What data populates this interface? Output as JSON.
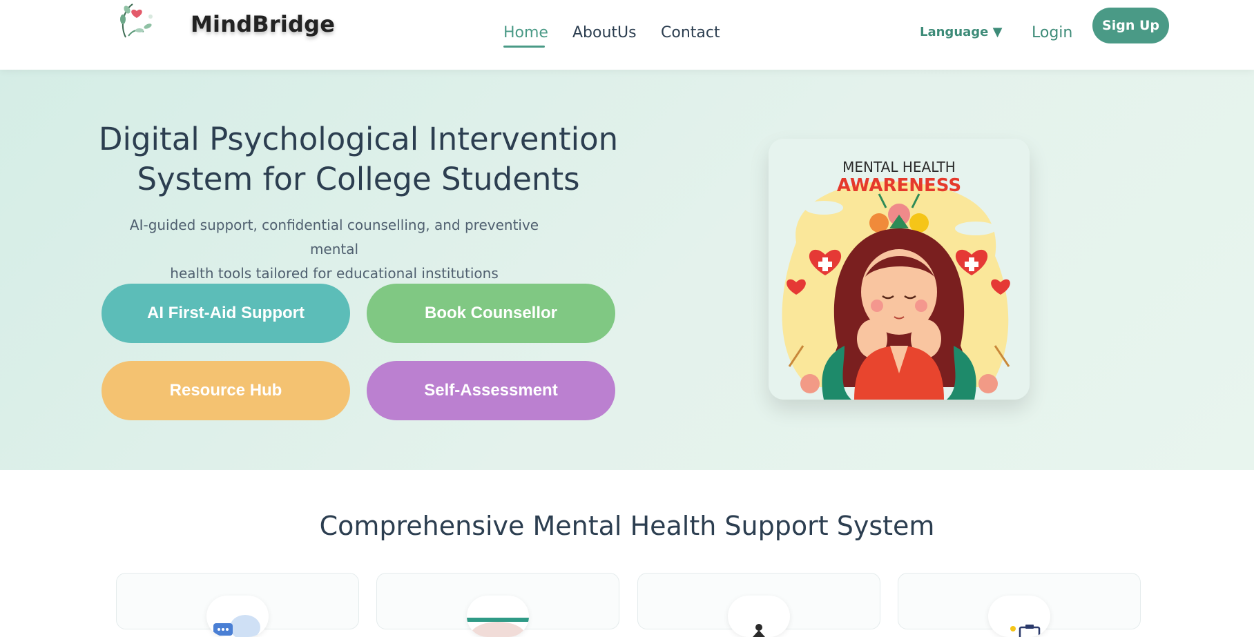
{
  "header": {
    "brand": "MindBridge",
    "nav": [
      "Home",
      "AboutUs",
      "Contact"
    ],
    "language_label": "Language ▼",
    "login_label": "Login",
    "signup_label": "Sign Up"
  },
  "hero": {
    "title_line1": "Digital Psychological Intervention",
    "title_line2": "System for College Students",
    "subtitle_line1": "AI-guided support, confidential counselling, and preventive mental",
    "subtitle_line2": "health tools tailored for educational institutions",
    "buttons": [
      "AI First-Aid Support",
      "Book Counsellor",
      "Resource Hub",
      "Self-Assessment"
    ],
    "poster": {
      "line1": "MENTAL HEALTH",
      "line2": "AWARENESS"
    }
  },
  "section": {
    "title": "Comprehensive Mental Health Support System",
    "cards": [
      {
        "icon": "chat-bubbles-icon"
      },
      {
        "icon": "counsellor-avatar-icon"
      },
      {
        "icon": "meditation-figure-icon"
      },
      {
        "icon": "clipboard-checklist-icon"
      }
    ]
  },
  "colors": {
    "accent": "#4a9a86",
    "ai_button": "#5cbdb8",
    "book_button": "#80c883",
    "resource_button": "#f4c271",
    "self_button": "#bb80d0",
    "hero_bg": "#e2f1eb"
  }
}
